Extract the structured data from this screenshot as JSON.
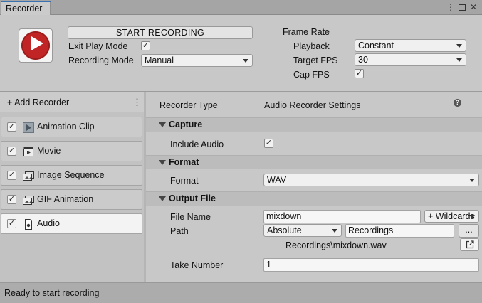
{
  "window": {
    "tab_label": "Recorder",
    "menu_icon": "kebab-menu-icon",
    "maximize_icon": "maximize-icon",
    "close_icon": "close-icon"
  },
  "top": {
    "start_button": "START RECORDING",
    "exit_play_mode_label": "Exit Play Mode",
    "exit_play_mode_checked": true,
    "recording_mode_label": "Recording Mode",
    "recording_mode_value": "Manual",
    "frame_rate_label": "Frame Rate",
    "playback_label": "Playback",
    "playback_value": "Constant",
    "target_fps_label": "Target FPS",
    "target_fps_value": "30",
    "cap_fps_label": "Cap FPS",
    "cap_fps_checked": true
  },
  "recorders": {
    "add_label": "+ Add Recorder",
    "items": [
      {
        "name": "Animation Clip",
        "icon": "animation-clip-icon",
        "checked": true
      },
      {
        "name": "Movie",
        "icon": "movie-icon",
        "checked": true
      },
      {
        "name": "Image Sequence",
        "icon": "image-sequence-icon",
        "checked": true
      },
      {
        "name": "GIF Animation",
        "icon": "gif-animation-icon",
        "checked": true
      },
      {
        "name": "Audio",
        "icon": "audio-icon",
        "checked": true,
        "selected": true
      }
    ]
  },
  "settings": {
    "recorder_type_label": "Recorder Type",
    "recorder_type_value": "Audio Recorder Settings",
    "capture_header": "Capture",
    "include_audio_label": "Include Audio",
    "include_audio_checked": true,
    "format_header": "Format",
    "format_label": "Format",
    "format_value": "WAV",
    "output_header": "Output File",
    "file_name_label": "File Name",
    "file_name_value": "mixdown",
    "wildcards_label": "+ Wildcards",
    "path_label": "Path",
    "path_mode_value": "Absolute",
    "path_value": "Recordings",
    "browse_label": "...",
    "output_path_preview": "Recordings\\mixdown.wav",
    "take_number_label": "Take Number",
    "take_number_value": "1"
  },
  "status": {
    "text": "Ready to start recording"
  },
  "colors": {
    "logo_red": "#c12424",
    "tab_accent": "#3a72b0",
    "selected_item_bg": "#f3f3f3"
  }
}
